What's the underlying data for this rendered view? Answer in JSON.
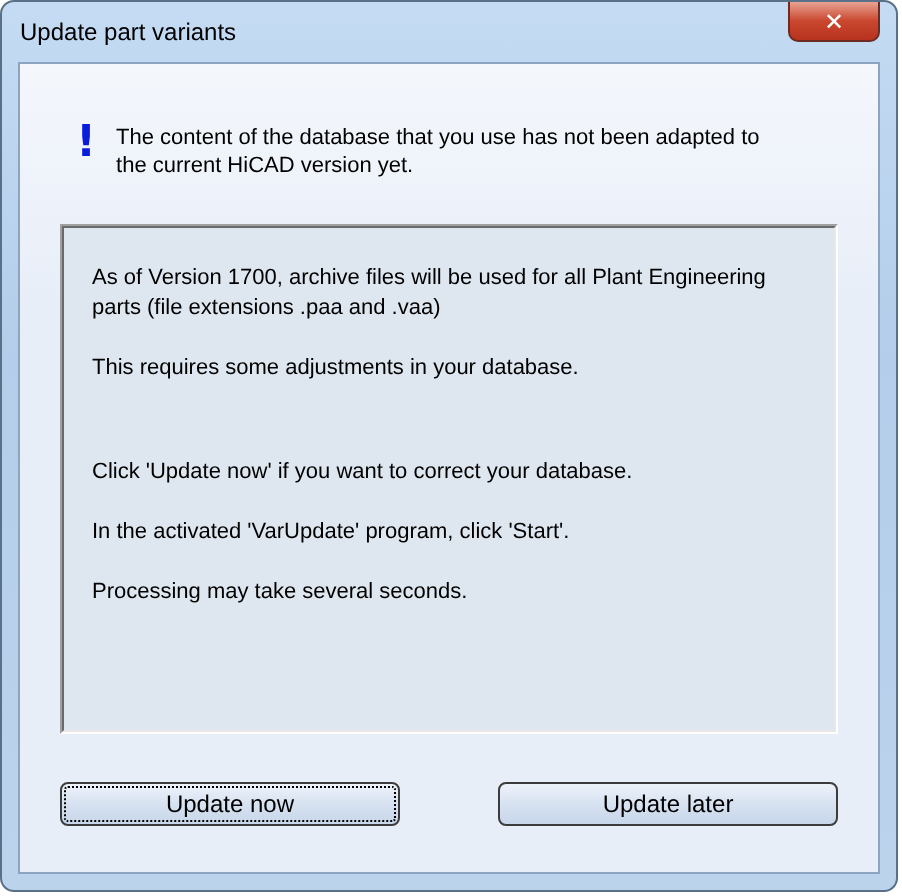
{
  "window": {
    "title": "Update part variants",
    "close": "✕"
  },
  "message": {
    "icon": "!",
    "text": "The content of the database that you use has not been adapted to the current HiCAD version yet."
  },
  "details": [
    "As of Version 1700, archive files will be used for all Plant Engineering parts (file extensions .paa and .vaa)",
    "This requires some adjustments in your database.",
    "Click 'Update now' if you want to correct your database.",
    "In the activated 'VarUpdate' program, click 'Start'.",
    "Processing may take several seconds."
  ],
  "buttons": [
    {
      "label": "Update now",
      "focused": true
    },
    {
      "label": "Update later",
      "focused": false
    }
  ]
}
